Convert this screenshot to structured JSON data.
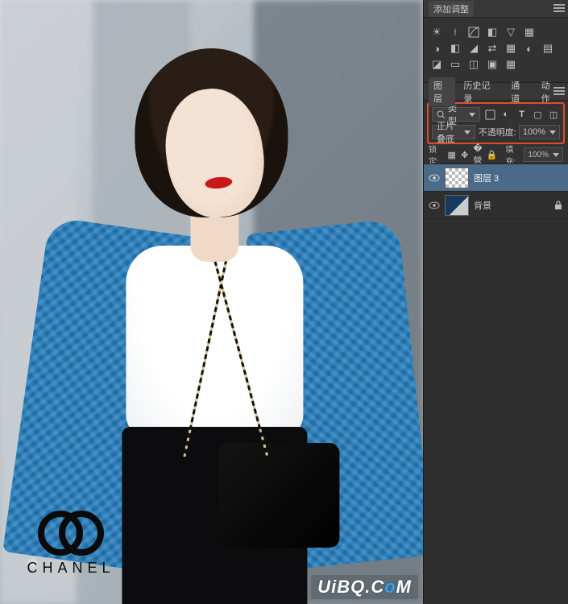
{
  "adjustments": {
    "title": "添加调整",
    "icons_row1": [
      "brightness-icon",
      "levels-icon",
      "curves-icon",
      "exposure-icon",
      "vibrance-icon",
      "hue-icon"
    ],
    "icons_row2": [
      "bw-icon",
      "photo-filter-icon",
      "channel-mixer-icon",
      "color-lookup-icon",
      "invert-icon",
      "posterize-icon",
      "threshold-icon"
    ],
    "icons_row3": [
      "gradient-map-icon",
      "selective-color-icon",
      "shadow-highlight-icon",
      "hdr-icon",
      "lut-icon"
    ]
  },
  "panels": {
    "tabs": [
      "图层",
      "历史记录",
      "通道",
      "动作"
    ],
    "active_tab": 0
  },
  "layers_options": {
    "filter_label": "类型",
    "blend_mode": "正片叠底",
    "opacity_label": "不透明度:",
    "opacity_value": "100%",
    "lock_label": "锁定:",
    "fill_label": "填充:",
    "fill_value": "100%"
  },
  "layers": [
    {
      "name": "图层 3",
      "visible": true,
      "selected": true,
      "thumb": "checker",
      "locked": false
    },
    {
      "name": "背景",
      "visible": true,
      "selected": false,
      "thumb": "photo",
      "locked": true
    }
  ],
  "logo": {
    "text": "CHANEL"
  },
  "watermark": {
    "left": "UiBQ.C",
    "o": "o",
    "right": "M"
  }
}
